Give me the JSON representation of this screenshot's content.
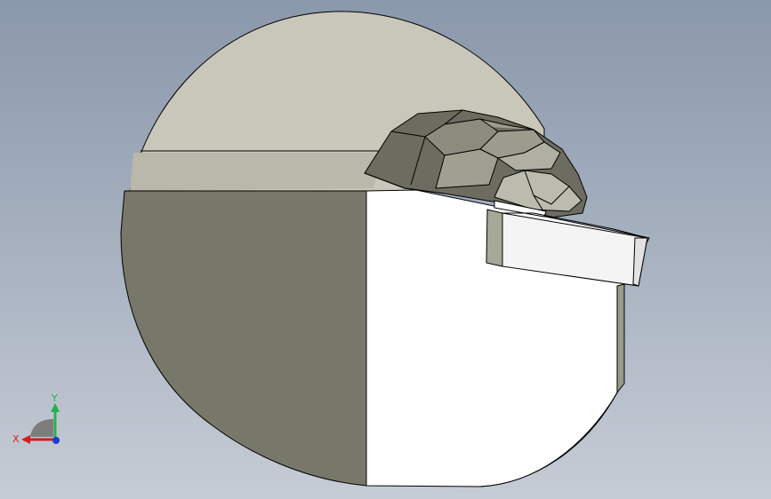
{
  "triad": {
    "x_label": "X",
    "y_label": "Y",
    "colors": {
      "x_axis": "#d21e1e",
      "y_axis": "#22b14c",
      "z_axis": "#1e3cd2",
      "base": "#7d7d7d"
    }
  },
  "model": {
    "colors": {
      "upper_face": "#c8c7b9",
      "left_face": "#78786a",
      "front_face": "#ffffff",
      "edge": "#000000",
      "cap_dark": "#6c6c60",
      "cap_mid": "#9c9c8e",
      "cap_light": "#bcbcae",
      "tab_face": "#f4f4f4",
      "tab_side": "#a8a89a"
    }
  }
}
